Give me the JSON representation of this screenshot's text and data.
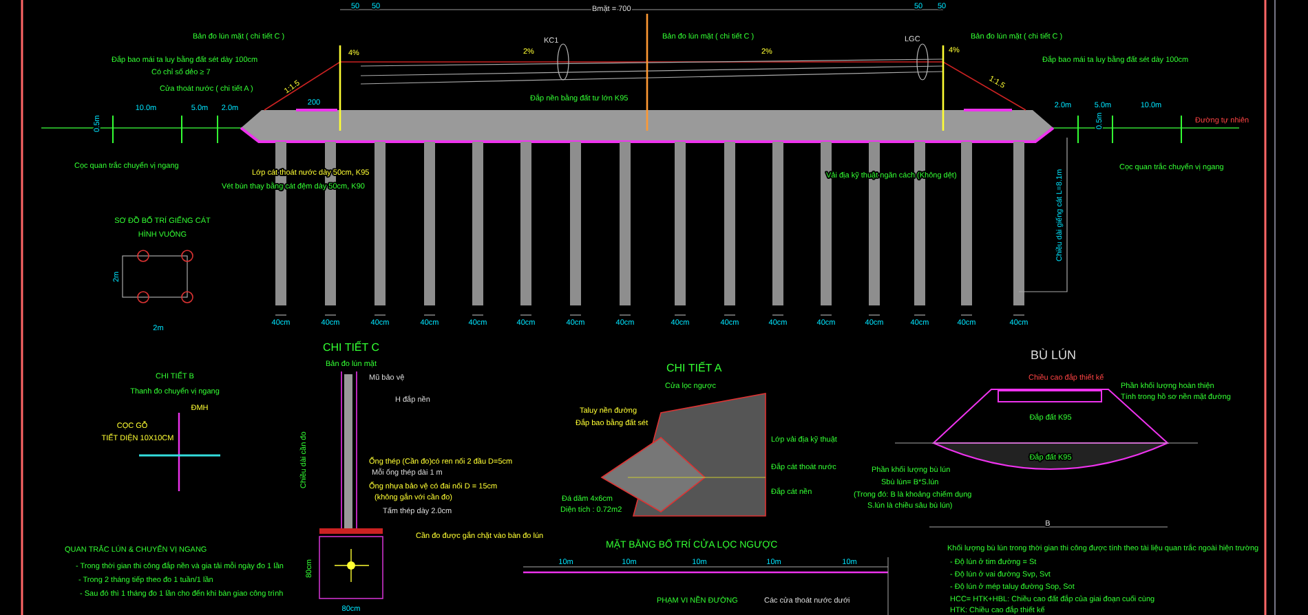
{
  "section_labels": [
    "Bmặt = 700",
    "50",
    "50",
    "50",
    "50",
    "Bản đo lún mặt ( chi tiết C )",
    "4%",
    "KC1",
    "2%",
    "Đắp bao mái ta luy bằng đất sét dày 100cm",
    "Có chỉ số dẻo ≥ 7",
    "Cửa thoát nước ( chi tiết A )",
    "1:1.5",
    "10.0m",
    "5.0m",
    "2.0m",
    "200",
    "0.5m",
    "Đắp nền bằng đất tư lớn K95",
    "Cọc quan trắc chuyển vị ngang",
    "Lớp cát thoát nước dày 50cm, K95",
    "Vét bùn thay bằng cát đệm dày 50cm, K90",
    "Bản đo lún mặt ( chi tiết C )",
    "2%",
    "LGC",
    "Bản đo lún mặt ( chi tiết C )",
    "4%",
    "Đắp bao mái ta luy bằng đất sét dày 100cm",
    "1:1.5",
    "2.0m",
    "5.0m",
    "10.0m",
    "0.5m",
    "Đường tự nhiên",
    "Vải địa kỹ thuật ngăn cách (Không dệt)",
    "Cọc quan trắc chuyển vị ngang",
    "Chiều dài giếng cát L=8.1m"
  ],
  "pile_widths": [
    "40cm",
    "40cm",
    "40cm",
    "40cm",
    "40cm",
    "40cm",
    "40cm",
    "40cm",
    "40cm",
    "40cm",
    "40cm",
    "40cm",
    "40cm",
    "40cm",
    "40cm",
    "40cm"
  ],
  "sand_well_layout": [
    "SƠ ĐỒ BỐ TRÍ GIẾNG CÁT",
    "HÌNH VUÔNG",
    "2m",
    "2m"
  ],
  "detail_c": [
    "CHI TIẾT C",
    "Bản đo lún mặt",
    "Mũ bảo vệ",
    "H đắp nền",
    "Chiều dài cần đo",
    "Ống thép (Cần đo)có ren nối 2 đầu D=5cm",
    "Mỗi ống thép dài 1 m",
    "Ống nhựa bảo vệ có đai nối D = 15cm",
    "(không gắn với cần đo)",
    "Tấm thép dày 2.0cm",
    "Cần đo được gắn chặt vào bàn đo lún",
    "80cm",
    "80cm"
  ],
  "detail_b": [
    "CHI TIẾT B",
    "Thanh đo chuyển vị ngang",
    "ĐMH",
    "CỌC GỖ",
    "TIẾT DIỆN 10X10CM"
  ],
  "monitoring_notes": [
    "QUAN TRẮC LÚN & CHUYỂN VỊ NGANG",
    "- Trong thời gian thi công đắp nền và gia tải mỗi ngày đo 1 lần",
    "- Trong 2 tháng tiếp theo đo 1 tuần/1 lần",
    "- Sau đó thì 1 tháng đo 1 lần cho đến khi bàn giao công trình"
  ],
  "detail_a": [
    "CHI TIẾT A",
    "Cửa lọc ngược",
    "Taluy nền đường",
    "Đắp bao bằng đất sét",
    "Lớp vải địa kỹ thuật",
    "Đắp cát thoát nước",
    "Đắp cát nền",
    "Đá dăm 4x6cm",
    "Diện tích : 0.72m2"
  ],
  "filter_plan": [
    "MẶT BẰNG BỐ TRÍ CỬA LỌC NGƯỢC",
    "10m",
    "10m",
    "10m",
    "10m",
    "10m",
    "PHẠM VI NỀN ĐƯỜNG",
    "Các cửa thoát nước dưới"
  ],
  "settlement": [
    "BÙ LÚN",
    "Chiều cao đắp thiết kế",
    "Phần khối lượng hoàn thiện",
    "Tính trong hồ sơ nền mặt đường",
    "Đắp đất K95",
    "Đắp đất K95",
    "Phần khối lượng bù lún",
    "Sbù lún= B*S.lún",
    "(Trong đó: B là khoảng chiếm dụng",
    "S.lún là chiều sâu bù lún)",
    "B"
  ],
  "settlement_notes": [
    "Khối lượng bù lún trong thời gian thi công được tính theo tài liệu quan trắc ngoài hiện trường",
    "- Độ lún ở tim đường = St",
    "- Độ lún ở vai đường Svp, Svt",
    "- Độ lún ở mép taluy đường Sop, Sot",
    "HCC= HTK+HBL: Chiều cao đất đắp của giai đoạn cuối cùng",
    "HTK: Chiều cao đắp thiết kế"
  ]
}
